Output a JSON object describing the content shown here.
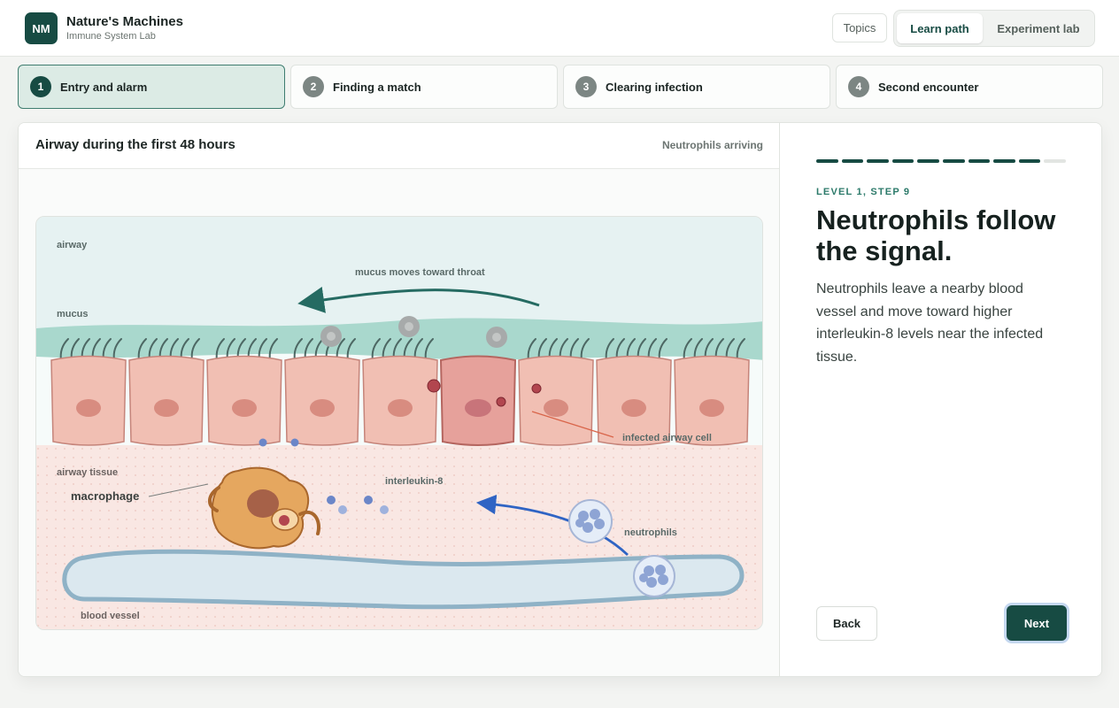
{
  "brand": {
    "logo": "NM",
    "title": "Nature's Machines",
    "subtitle": "Immune System Lab"
  },
  "nav": {
    "topics": "Topics",
    "modes": [
      "Learn path",
      "Experiment lab"
    ],
    "active_mode": "Learn path"
  },
  "steps": [
    {
      "num": "1",
      "label": "Entry and alarm",
      "active": true
    },
    {
      "num": "2",
      "label": "Finding a match",
      "active": false
    },
    {
      "num": "3",
      "label": "Clearing infection",
      "active": false
    },
    {
      "num": "4",
      "label": "Second encounter",
      "active": false
    }
  ],
  "panel": {
    "title": "Airway during the first 48 hours",
    "status": "Neutrophils arriving"
  },
  "diagram": {
    "labels": {
      "airway": "airway",
      "mucus_flow": "mucus moves toward throat",
      "mucus": "mucus",
      "infected_cell": "infected airway cell",
      "airway_tissue": "airway tissue",
      "macrophage": "macrophage",
      "interleukin": "interleukin-8",
      "neutrophils": "neutrophils",
      "blood_vessel": "blood vessel"
    },
    "colors": {
      "mucus_arrow": "#256b62",
      "migration_arrow": "#2f64c4",
      "infected_cell": "#e6a19b",
      "macrophage": "#e5a75f",
      "neutrophil": "#8ea4d4"
    }
  },
  "lesson": {
    "progress": {
      "completed": 9,
      "total": 10
    },
    "level_label": "LEVEL 1, STEP 9",
    "title": "Neutrophils follow the signal.",
    "body": "Neutrophils leave a nearby blood vessel and move toward higher interleukin-8 levels near the infected tissue.",
    "back": "Back",
    "next": "Next"
  }
}
